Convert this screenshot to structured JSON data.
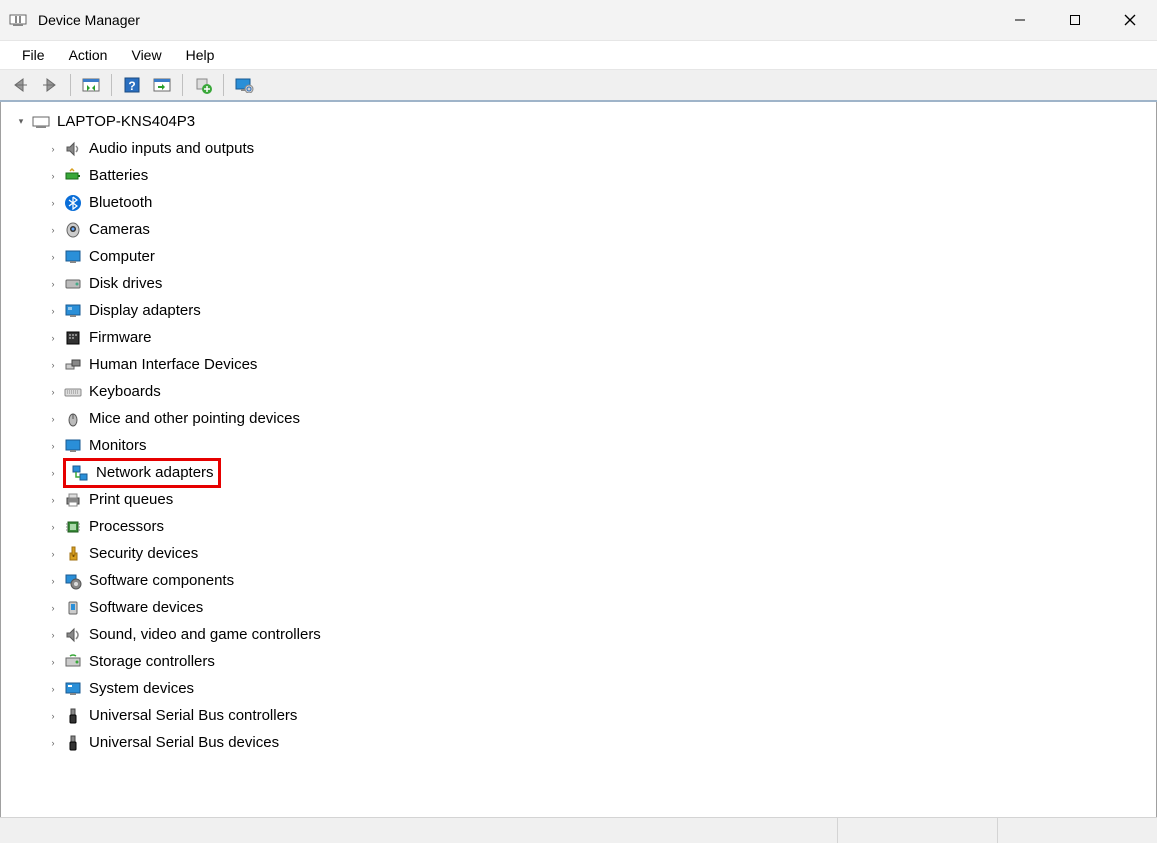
{
  "title": "Device Manager",
  "menu": {
    "file": "File",
    "action": "Action",
    "view": "View",
    "help": "Help"
  },
  "root": {
    "label": "LAPTOP-KNS404P3"
  },
  "categories": [
    {
      "label": "Audio inputs and outputs",
      "icon": "speaker"
    },
    {
      "label": "Batteries",
      "icon": "battery"
    },
    {
      "label": "Bluetooth",
      "icon": "bluetooth"
    },
    {
      "label": "Cameras",
      "icon": "camera"
    },
    {
      "label": "Computer",
      "icon": "monitor"
    },
    {
      "label": "Disk drives",
      "icon": "disk"
    },
    {
      "label": "Display adapters",
      "icon": "display"
    },
    {
      "label": "Firmware",
      "icon": "firmware"
    },
    {
      "label": "Human Interface Devices",
      "icon": "hid"
    },
    {
      "label": "Keyboards",
      "icon": "keyboard"
    },
    {
      "label": "Mice and other pointing devices",
      "icon": "mouse"
    },
    {
      "label": "Monitors",
      "icon": "monitor2"
    },
    {
      "label": "Network adapters",
      "icon": "network",
      "highlighted": true
    },
    {
      "label": "Print queues",
      "icon": "printer"
    },
    {
      "label": "Processors",
      "icon": "cpu"
    },
    {
      "label": "Security devices",
      "icon": "security"
    },
    {
      "label": "Software components",
      "icon": "software"
    },
    {
      "label": "Software devices",
      "icon": "softdev"
    },
    {
      "label": "Sound, video and game controllers",
      "icon": "sound"
    },
    {
      "label": "Storage controllers",
      "icon": "storage"
    },
    {
      "label": "System devices",
      "icon": "system"
    },
    {
      "label": "Universal Serial Bus controllers",
      "icon": "usb"
    },
    {
      "label": "Universal Serial Bus devices",
      "icon": "usbdev"
    }
  ]
}
